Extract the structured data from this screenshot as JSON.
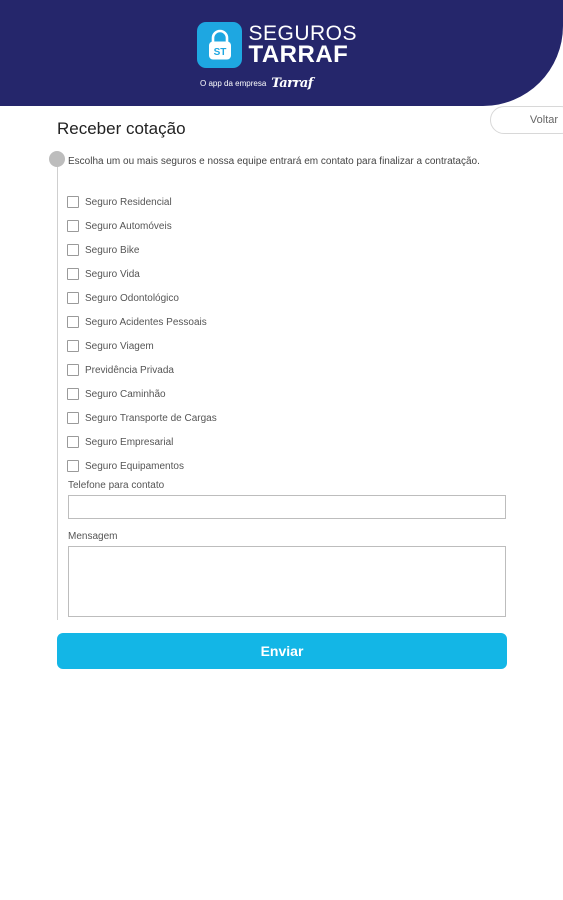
{
  "brand": {
    "icon_letters": "ST",
    "line1": "SEGUROS",
    "line2": "TARRAF",
    "tagline": "O app da empresa",
    "company_logo": "Tarraf"
  },
  "back_label": "Voltar",
  "page_title": "Receber cotação",
  "intro_text": "Escolha um ou mais seguros e nossa equipe entrará em contato para finalizar a contratação.",
  "options": [
    {
      "label": "Seguro Residencial",
      "checked": false
    },
    {
      "label": "Seguro Automóveis",
      "checked": false
    },
    {
      "label": "Seguro Bike",
      "checked": false
    },
    {
      "label": "Seguro Vida",
      "checked": false
    },
    {
      "label": "Seguro Odontológico",
      "checked": false
    },
    {
      "label": "Seguro Acidentes Pessoais",
      "checked": false
    },
    {
      "label": "Seguro Viagem",
      "checked": false
    },
    {
      "label": "Previdência Privada",
      "checked": false
    },
    {
      "label": "Seguro Caminhão",
      "checked": false
    },
    {
      "label": "Seguro Transporte de Cargas",
      "checked": false
    },
    {
      "label": "Seguro Empresarial",
      "checked": false
    },
    {
      "label": "Seguro Equipamentos",
      "checked": false
    }
  ],
  "phone": {
    "label": "Telefone para contato",
    "value": ""
  },
  "message": {
    "label": "Mensagem",
    "value": ""
  },
  "submit_label": "Enviar",
  "colors": {
    "header_bg": "#25266b",
    "accent": "#13b6e6",
    "logo_badge": "#1ea7e1"
  }
}
